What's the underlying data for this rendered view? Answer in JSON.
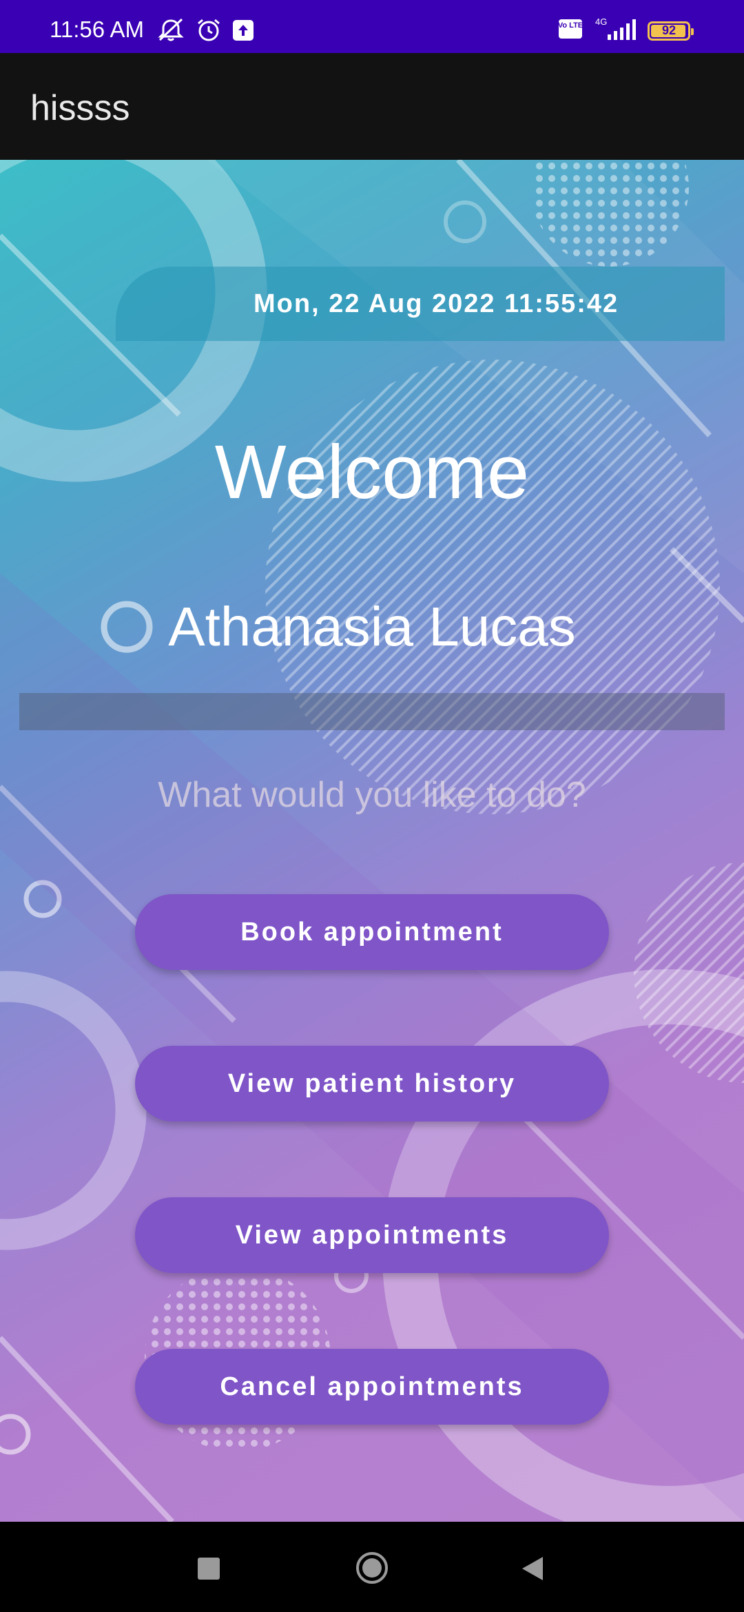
{
  "status_bar": {
    "time": "11:56 AM",
    "battery_level": "92",
    "network_label": "4G",
    "volte_label": "Vo LTE",
    "icons": [
      "mute-icon",
      "alarm-icon",
      "upload-icon",
      "volte-icon",
      "signal-icon",
      "battery-icon"
    ]
  },
  "app_bar": {
    "title": "hissss"
  },
  "main": {
    "datetime": "Mon, 22 Aug 2022 11:55:42",
    "welcome": "Welcome",
    "user_name": "Athanasia Lucas",
    "prompt": "What would you like to do?",
    "buttons": {
      "book": "Book appointment",
      "history": "View patient history",
      "view": "View appointments",
      "cancel": "Cancel appointments"
    }
  },
  "nav_bar": {
    "icons": [
      "recents-icon",
      "home-icon",
      "back-icon"
    ]
  },
  "colors": {
    "status_bar": "#3a00b4",
    "app_bar": "#121212",
    "button": "#7f55c8",
    "battery": "#f2c14e"
  }
}
